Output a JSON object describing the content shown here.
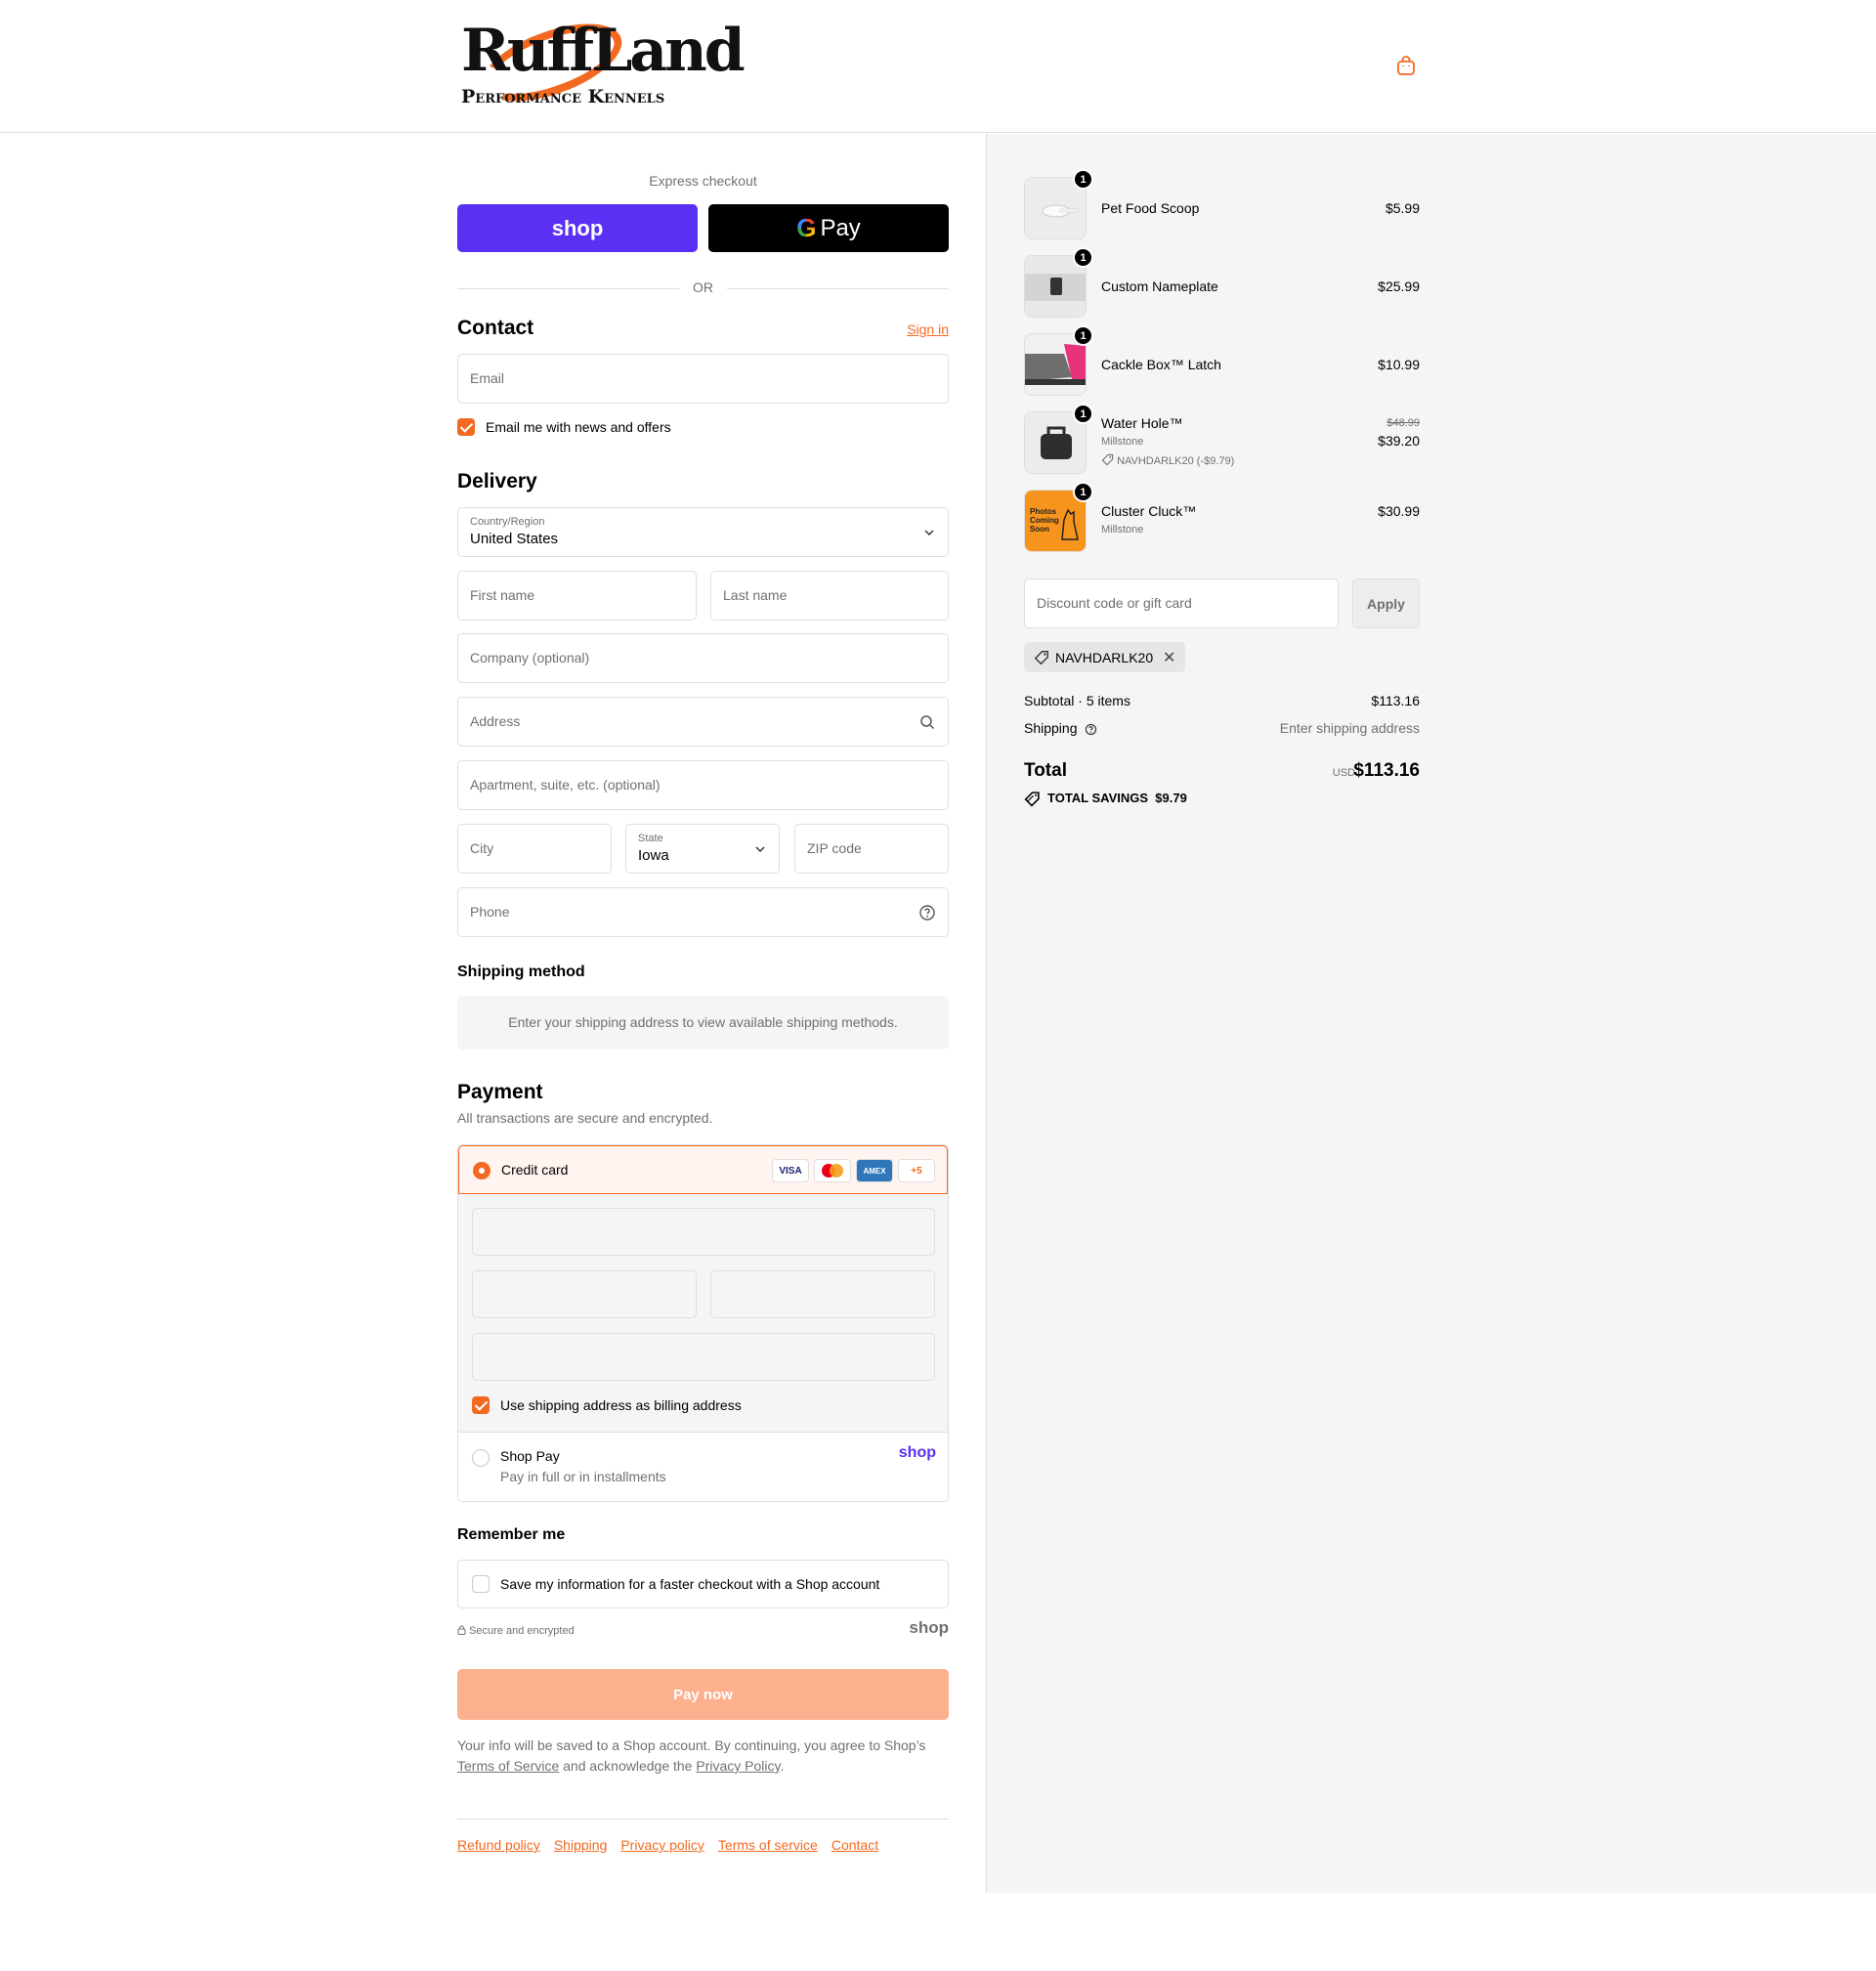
{
  "brand": {
    "logo_main": "RuffLand",
    "logo_sub": "Performance Kennels",
    "accent": "#f26a21",
    "shop_purple": "#5a31f4"
  },
  "header": {
    "cart_icon": "shopping-bag-icon"
  },
  "express": {
    "label": "Express checkout",
    "shop_button": "shop",
    "gpay_g": "G",
    "gpay_pay": "Pay",
    "or": "OR"
  },
  "contact": {
    "title": "Contact",
    "signin": "Sign in",
    "email_placeholder": "Email",
    "newsletter_label": "Email me with news and offers"
  },
  "delivery": {
    "title": "Delivery",
    "country_label": "Country/Region",
    "country_value": "United States",
    "first_name": "First name",
    "last_name": "Last name",
    "company": "Company (optional)",
    "address": "Address",
    "apartment": "Apartment, suite, etc. (optional)",
    "city": "City",
    "state_label": "State",
    "state_value": "Iowa",
    "zip": "ZIP code",
    "phone": "Phone"
  },
  "shipping_method": {
    "title": "Shipping method",
    "info": "Enter your shipping address to view available shipping methods."
  },
  "payment": {
    "title": "Payment",
    "subtitle": "All transactions are secure and encrypted.",
    "credit_card_label": "Credit card",
    "cards": [
      "VISA",
      "",
      "AMEX",
      "+5"
    ],
    "billing_same": "Use shipping address as billing address",
    "shoppay_title": "Shop Pay",
    "shoppay_sub": "Pay in full or in installments",
    "shoppay_logo": "shop"
  },
  "remember": {
    "title": "Remember me",
    "save_label": "Save my information for a faster checkout with a Shop account",
    "secure": "Secure and encrypted",
    "shop_logo": "shop"
  },
  "pay_now": "Pay now",
  "legal": {
    "text1": "Your info will be saved to a Shop account. By continuing, you agree to Shop’s",
    "tos": "Terms of Service",
    "text2": "and acknowledge the",
    "privacy": "Privacy Policy",
    "text3": "."
  },
  "footer": [
    "Refund policy",
    "Shipping",
    "Privacy policy",
    "Terms of service",
    "Contact"
  ],
  "summary": {
    "items": [
      {
        "name": "Pet Food Scoop",
        "qty": "1",
        "price": "$5.99",
        "variant": "",
        "discount": "",
        "original": ""
      },
      {
        "name": "Custom Nameplate",
        "qty": "1",
        "price": "$25.99",
        "variant": "",
        "discount": "",
        "original": ""
      },
      {
        "name": "Cackle Box™ Latch",
        "qty": "1",
        "price": "$10.99",
        "variant": "",
        "discount": "",
        "original": ""
      },
      {
        "name": "Water Hole™",
        "qty": "1",
        "price": "$39.20",
        "variant": "Millstone",
        "discount": "NAVHDARLK20 (-$9.79)",
        "original": "$48.99"
      },
      {
        "name": "Cluster Cluck™",
        "qty": "1",
        "price": "$30.99",
        "variant": "Millstone",
        "discount": "",
        "original": "",
        "thumb_text": "Photos Coming Soon"
      }
    ],
    "discount_placeholder": "Discount code or gift card",
    "apply": "Apply",
    "applied_code": "NAVHDARLK20",
    "subtotal_label": "Subtotal · 5 items",
    "subtotal_value": "$113.16",
    "shipping_label": "Shipping",
    "shipping_value": "Enter shipping address",
    "total_label": "Total",
    "currency": "USD",
    "total_value": "$113.16",
    "savings_label": "TOTAL SAVINGS",
    "savings_value": "$9.79"
  }
}
